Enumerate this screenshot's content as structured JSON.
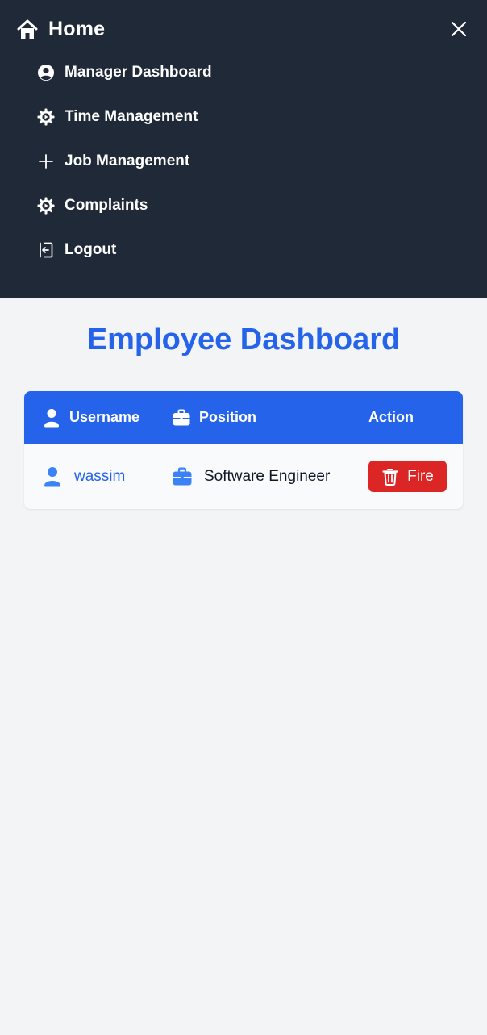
{
  "nav": {
    "home": {
      "label": "Home",
      "icon": "home-icon"
    },
    "close": {
      "icon": "close-icon"
    },
    "items": [
      {
        "label": "Manager Dashboard",
        "icon": "user-circle-icon"
      },
      {
        "label": "Time Management",
        "icon": "gear-icon"
      },
      {
        "label": "Job Management",
        "icon": "plus-icon"
      },
      {
        "label": "Complaints",
        "icon": "gear-icon"
      },
      {
        "label": "Logout",
        "icon": "logout-icon"
      }
    ]
  },
  "main": {
    "title": "Employee Dashboard",
    "table": {
      "headers": [
        {
          "label": "Username",
          "icon": "user-icon"
        },
        {
          "label": "Position",
          "icon": "briefcase-icon"
        },
        {
          "label": "Action"
        }
      ],
      "rows": [
        {
          "username": "wassim",
          "position": "Software Engineer",
          "action_label": "Fire",
          "action_icon": "trash-icon"
        }
      ]
    }
  },
  "colors": {
    "nav_bg": "#1f2937",
    "accent": "#2563eb",
    "danger": "#dc2626",
    "page_bg": "#f3f4f6"
  }
}
